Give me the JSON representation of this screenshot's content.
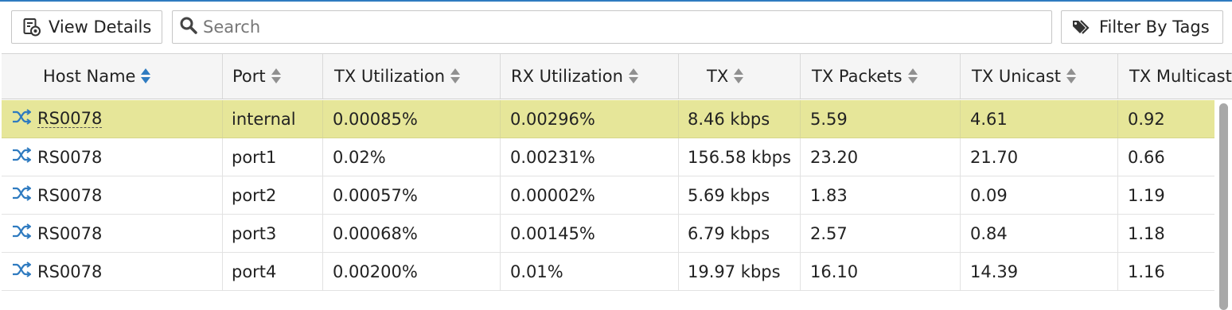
{
  "toolbar": {
    "view_details_label": "View Details",
    "search_placeholder": "Search",
    "search_value": "",
    "filter_tags_label": "Filter By Tags"
  },
  "colors": {
    "accent": "#2f7bc0",
    "selected_row": "#e6e699",
    "header_bg": "#f5f5f5"
  },
  "table": {
    "columns": [
      {
        "label": "Host Name",
        "sort": "active"
      },
      {
        "label": "Port",
        "sort": "none"
      },
      {
        "label": "TX Utilization",
        "sort": "none"
      },
      {
        "label": "RX Utilization",
        "sort": "none"
      },
      {
        "label": "TX",
        "sort": "none"
      },
      {
        "label": "TX Packets",
        "sort": "none"
      },
      {
        "label": "TX Unicast",
        "sort": "none"
      },
      {
        "label": "TX Multicast",
        "sort": "none"
      }
    ],
    "rows": [
      {
        "host_icon": "switch-icon",
        "host": "RS0078",
        "port": "internal",
        "tx_util": "0.00085%",
        "rx_util": "0.00296%",
        "tx": "8.46 kbps",
        "tx_packets": "5.59",
        "tx_unicast": "4.61",
        "tx_multicast": "0.92",
        "selected": true
      },
      {
        "host_icon": "switch-icon",
        "host": "RS0078",
        "port": "port1",
        "tx_util": "0.02%",
        "rx_util": "0.00231%",
        "tx": "156.58 kbps",
        "tx_packets": "23.20",
        "tx_unicast": "21.70",
        "tx_multicast": "0.66",
        "selected": false
      },
      {
        "host_icon": "switch-icon",
        "host": "RS0078",
        "port": "port2",
        "tx_util": "0.00057%",
        "rx_util": "0.00002%",
        "tx": "5.69 kbps",
        "tx_packets": "1.83",
        "tx_unicast": "0.09",
        "tx_multicast": "1.19",
        "selected": false
      },
      {
        "host_icon": "switch-icon",
        "host": "RS0078",
        "port": "port3",
        "tx_util": "0.00068%",
        "rx_util": "0.00145%",
        "tx": "6.79 kbps",
        "tx_packets": "2.57",
        "tx_unicast": "0.84",
        "tx_multicast": "1.18",
        "selected": false
      },
      {
        "host_icon": "switch-icon",
        "host": "RS0078",
        "port": "port4",
        "tx_util": "0.00200%",
        "rx_util": "0.01%",
        "tx": "19.97 kbps",
        "tx_packets": "16.10",
        "tx_unicast": "14.39",
        "tx_multicast": "1.16",
        "selected": false
      }
    ]
  }
}
